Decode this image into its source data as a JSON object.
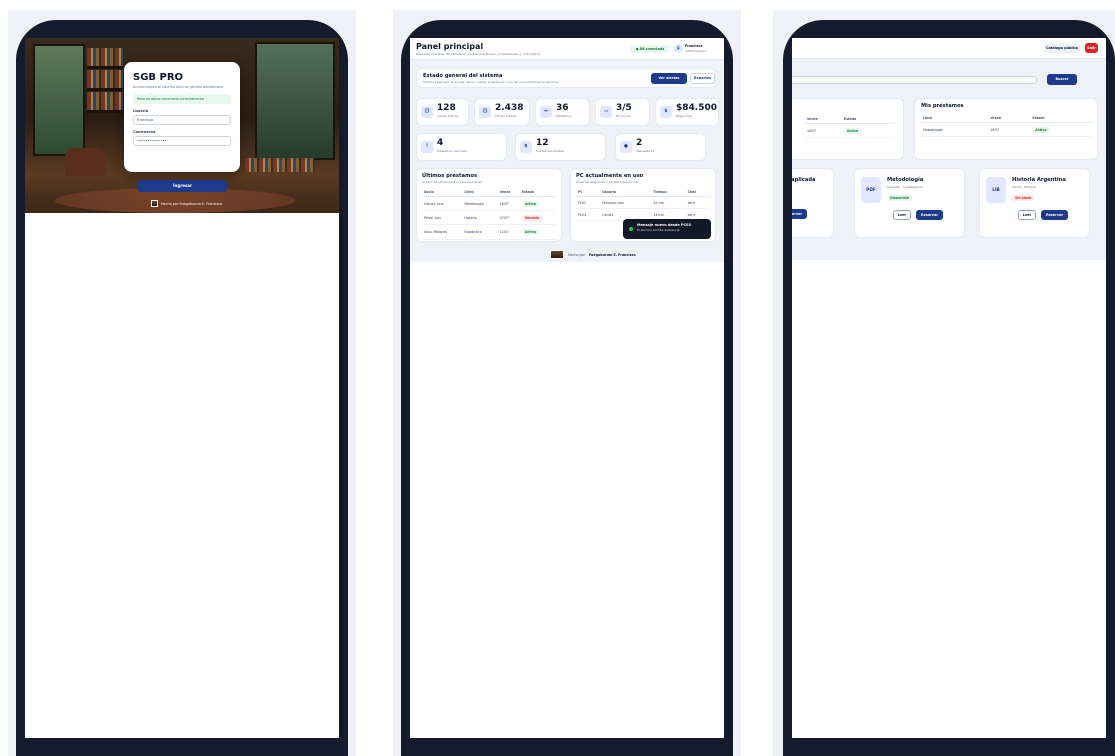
{
  "login": {
    "brand": "SGB PRO",
    "subtitle": "Acceso seguro al sistema local de gestión bibliotecaria",
    "db_status": "Base de datos conectada correctamente",
    "user_label": "Usuario",
    "user_value": "francisco",
    "password_label": "Contraseña",
    "password_value": "••••••••••••••",
    "submit_label": "Ingresar",
    "credit": "Hecho por Fuegoburum E. Francisco"
  },
  "dashboard": {
    "title": "Panel principal",
    "subtitle": "Resumen operativo de biblioteca, cuotas, préstamos, computadoras y chat interno",
    "db_pill": "● DB conectada",
    "user_initial": "F",
    "user_name": "Francisco",
    "user_role": "administrador",
    "system_title": "Estado general del sistema",
    "system_subtitle": "Control integrado de socios, libros, cuotas, préstamos y uso de computadoras de alumnos.",
    "alerts_btn": "Ver alertas",
    "reports_btn": "Reportes",
    "stats": [
      {
        "icon": "[]",
        "value": "128",
        "label": "Socios activos"
      },
      {
        "icon": "[]",
        "value": "2.438",
        "label": "Títulos activos"
      },
      {
        "icon": "↔",
        "value": "36",
        "label": "Préstamos"
      },
      {
        "icon": "▭",
        "value": "3/5",
        "label": "PC en uso"
      },
      {
        "icon": "$",
        "value": "$84.500",
        "label": "Pagos mes"
      },
      {
        "icon": "!",
        "value": "4",
        "label": "Préstamos vencidos"
      },
      {
        "icon": "$",
        "value": "12",
        "label": "Cuotas pendientes"
      },
      {
        "icon": "●",
        "value": "2",
        "label": "Mensajes PC"
      }
    ],
    "loans": {
      "title": "Últimos préstamos",
      "subtitle": "Control de vencimientos y devoluciones",
      "headers": [
        "Socio",
        "Libro",
        "Vence",
        "Estado"
      ],
      "rows": [
        {
          "socio": "Gómez, Ana",
          "libro": "Metodología",
          "vence": "16/07",
          "estado": "Activo",
          "ok": true
        },
        {
          "socio": "Pérez, Luis",
          "libro": "Historia",
          "vence": "07/07",
          "estado": "Vencido",
          "ok": false
        },
        {
          "socio": "Sosa, Milagros",
          "libro": "Estadística",
          "vence": "12/07",
          "estado": "Activo",
          "ok": true
        }
      ]
    },
    "pcs": {
      "title": "PC actualmente en uso",
      "subtitle": "Usuarios asignados y tiempo transcurrido",
      "headers": [
        "PC",
        "Usuario",
        "Tiempo",
        "Chat"
      ],
      "rows": [
        {
          "pc": "PC02",
          "usuario": "Ferlanda Juan",
          "tiempo": "42 min",
          "chat": "abrir"
        },
        {
          "pc": "PC04",
          "usuario": "Camila",
          "tiempo": "14 min",
          "chat": "abrir"
        }
      ]
    },
    "toast_title": "Mensaje nuevo desde PC03",
    "toast_sub": "El alumno solicita asistencia.",
    "footer_prefix": "Hecho por",
    "footer_name": "Fuegoburum E. Francisco"
  },
  "student": {
    "catalog_btn": "Catálogo público",
    "exit_btn": "Salir",
    "search_btn": "Buscar",
    "left_table": {
      "headers": [
        "Vence",
        "Estado"
      ],
      "row": {
        "vence": "16/07",
        "estado": "Activo"
      }
    },
    "my_loans": {
      "title": "Mis préstamos",
      "headers": [
        "Libro",
        "Vence",
        "Estado"
      ],
      "row": {
        "libro": "Metodología",
        "vence": "16/07",
        "estado": "Activo"
      }
    },
    "books": [
      {
        "title": "aplicada",
        "reserve": "servar"
      },
      {
        "icon": "PDF",
        "title": "Metodología",
        "meta": "Sampieri · Investigación",
        "status": "Disponible",
        "available": true,
        "read": "Leer",
        "reserve": "Reservar"
      },
      {
        "icon": "LIB",
        "title": "Historia Argentina",
        "meta": "Varios · Historia",
        "status": "Sin stock",
        "available": false,
        "read": "Leer",
        "reserve": "Reservar"
      }
    ]
  }
}
